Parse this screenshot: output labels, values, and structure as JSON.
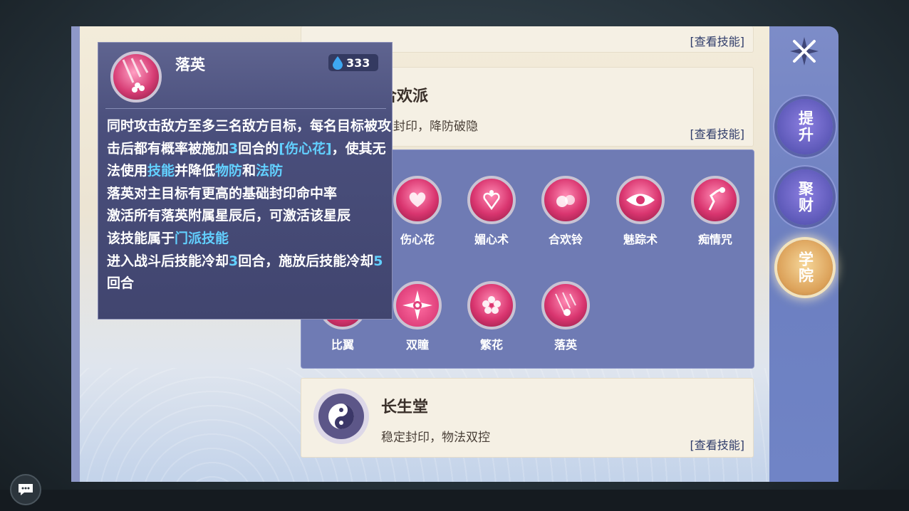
{
  "panel": {
    "top_view_link": "[查看技能]"
  },
  "sects": [
    {
      "name": "合欢派",
      "desc": "速封印，降防破隐",
      "link": "[查看技能]"
    },
    {
      "name": "长生堂",
      "desc": "稳定封印，物法双控",
      "link": "[查看技能]"
    }
  ],
  "skills": [
    {
      "label": "伤心花",
      "icon": "heart-flower-icon"
    },
    {
      "label": "媚心术",
      "icon": "charm-heart-icon"
    },
    {
      "label": "合欢铃",
      "icon": "bell-icon"
    },
    {
      "label": "魅踪术",
      "icon": "eye-icon"
    },
    {
      "label": "痴情咒",
      "icon": "dancer-icon"
    },
    {
      "label": "比翼",
      "icon": "wings-icon"
    },
    {
      "label": "双瞳",
      "icon": "double-eye-icon"
    },
    {
      "label": "繁花",
      "icon": "blossom-icon"
    },
    {
      "label": "落英",
      "icon": "falling-petal-icon"
    }
  ],
  "sidebar": {
    "close_icon": "close-x-icon",
    "buttons": [
      {
        "label": "提升",
        "active": false
      },
      {
        "label": "聚财",
        "active": false
      },
      {
        "label": "学院",
        "active": true
      }
    ]
  },
  "tooltip": {
    "name": "落英",
    "cost": "333",
    "lines": {
      "l1": "同时攻击敌方至多三名敌方目标，每名目标被攻击后都有概率被施加",
      "rounds1": "3",
      "l1b": "回合的",
      "status": "[伤心花]",
      "l1c": "，使其无法使用",
      "skill_word": "技能",
      "l1d": "并降低",
      "phys": "物防",
      "and": "和",
      "magic": "法防",
      "l2": "落英对主目标有更高的基础封印命中率",
      "l3": "激活所有落英附属星辰后，可激活该星辰",
      "l4a": "该技能属于",
      "l4b": "门派技能",
      "l5a": "进入战斗后技能冷却",
      "cd1": "3",
      "l5b": "回合，施放后技能冷却",
      "cd2": "5",
      "l5c": "回合"
    }
  },
  "colors": {
    "highlight": "#62d0ff",
    "sidebar": "#6c7fc0",
    "skill_panel": "#6f7bb4"
  }
}
